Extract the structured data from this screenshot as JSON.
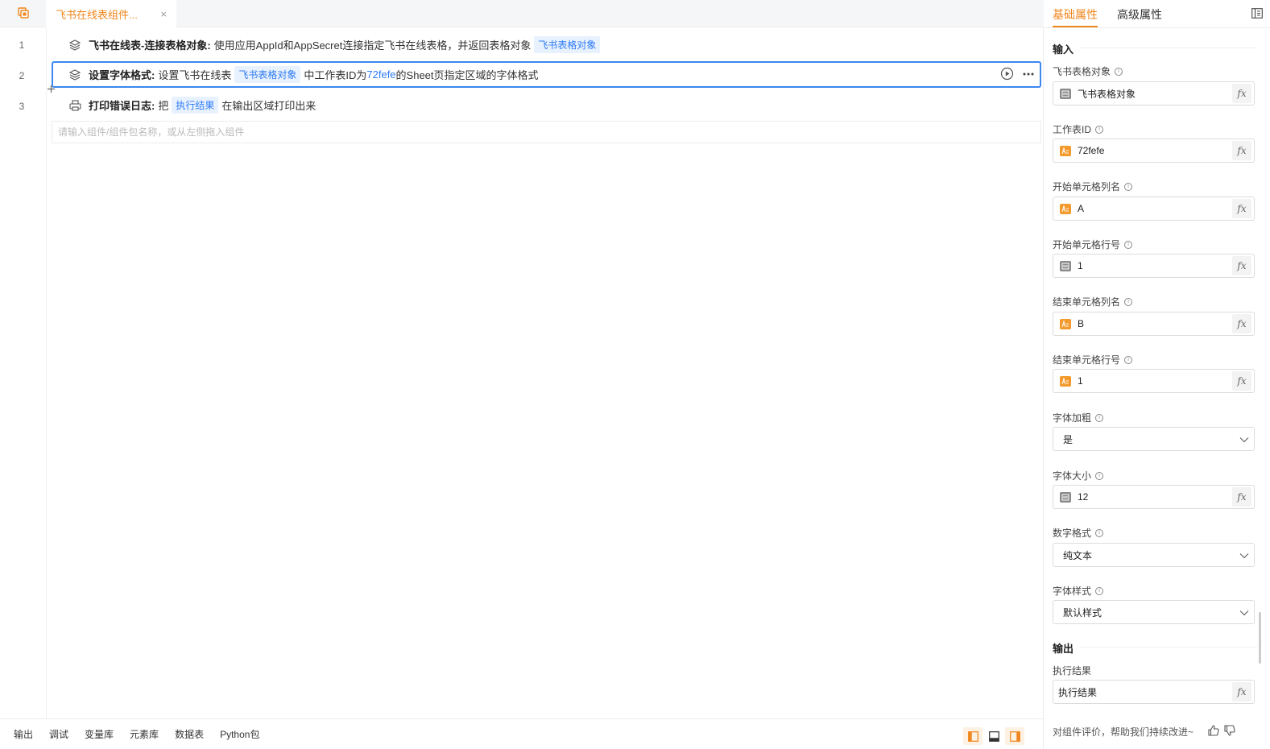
{
  "tabs": {
    "active_title": "飞书在线表组件...",
    "close_glyph": "×"
  },
  "lines": [
    {
      "no": "1",
      "title": "飞书在线表-连接表格对象:",
      "desc": "使用应用AppId和AppSecret连接指定飞书在线表格，并返回表格对象",
      "chip": "飞书表格对象",
      "icon": "layers-icon"
    },
    {
      "no": "2",
      "title": "设置字体格式:",
      "desc_1": "设置飞书在线表",
      "chip": "飞书表格对象",
      "desc_2": "中工作表ID为",
      "var": "72fefe",
      "desc_3": "的Sheet页指定区域的字体格式",
      "icon": "layers-icon"
    },
    {
      "no": "3",
      "title": "打印错误日志:",
      "desc_1": "把",
      "chip": "执行结果",
      "desc_2": "在输出区域打印出来",
      "icon": "printer-icon"
    }
  ],
  "search": {
    "placeholder": "请输入组件/组件包名称，或从左侧拖入组件"
  },
  "bottom_tabs": [
    "输出",
    "调试",
    "变量库",
    "元素库",
    "数据表",
    "Python包"
  ],
  "panel": {
    "tabs": [
      "基础属性",
      "高级属性"
    ],
    "input_title": "输入",
    "output_title": "输出",
    "fields": [
      {
        "label": "飞书表格对象",
        "value": "飞书表格对象",
        "type": "gray"
      },
      {
        "label": "工作表ID",
        "value": "72fefe",
        "type": "orange"
      },
      {
        "label": "开始单元格列名",
        "value": "A",
        "type": "orange"
      },
      {
        "label": "开始单元格行号",
        "value": "1",
        "type": "gray"
      },
      {
        "label": "结束单元格列名",
        "value": "B",
        "type": "orange"
      },
      {
        "label": "结束单元格行号",
        "value": "1",
        "type": "orange"
      }
    ],
    "selects": [
      {
        "label": "字体加粗",
        "value": "是"
      }
    ],
    "font_size": {
      "label": "字体大小",
      "value": "12"
    },
    "selects_2": [
      {
        "label": "数字格式",
        "value": "纯文本"
      },
      {
        "label": "字体样式",
        "value": "默认样式"
      }
    ],
    "output_field": {
      "label": "执行结果",
      "value": "执行结果"
    },
    "feedback": "对组件评价，帮助我们持续改进~",
    "fx": "fx"
  },
  "colors": {
    "accent": "#f0861c",
    "selection": "#3b87f0",
    "chip_bg": "#e8f1fe",
    "chip_text": "#2f7cf6"
  }
}
